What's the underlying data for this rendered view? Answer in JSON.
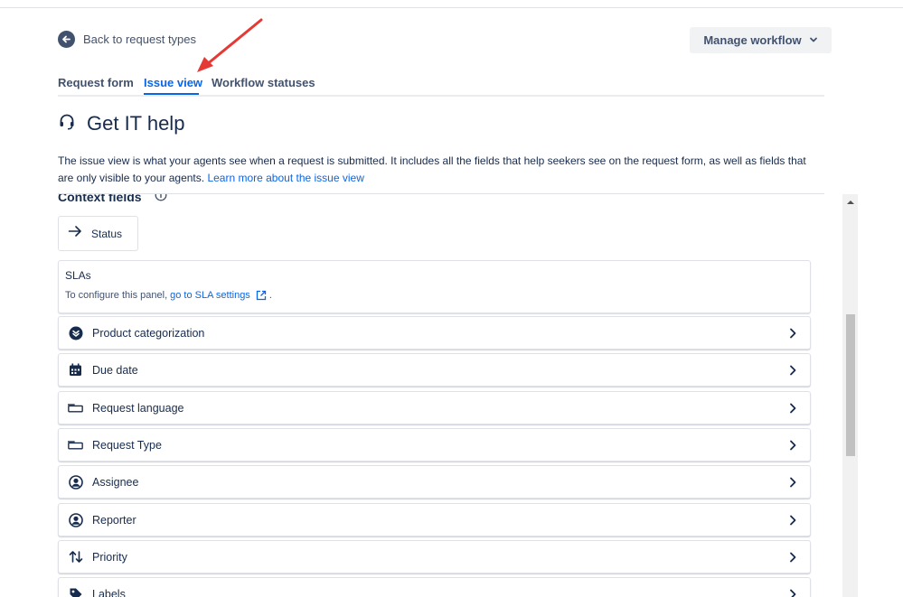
{
  "nav": {
    "back_label": "Back to request types",
    "back_icon": "arrow-left-circle-icon"
  },
  "header": {
    "manage_workflow_label": "Manage workflow",
    "manage_workflow_icon": "chevron-down-icon"
  },
  "tabs": [
    {
      "label": "Request form",
      "active": false
    },
    {
      "label": "Issue view",
      "active": true
    },
    {
      "label": "Workflow statuses",
      "active": false
    }
  ],
  "page": {
    "title": "Get IT help",
    "title_icon": "headset-icon",
    "description": "The issue view is what your agents see when a request is submitted. It includes all the fields that help seekers see on the request form, as well as fields that are only visible to your agents.",
    "learn_more_link": "Learn more about the issue view"
  },
  "context": {
    "heading": "Context fields",
    "info_icon": "info-icon",
    "status_label": "Status",
    "status_icon": "arrow-right-icon"
  },
  "sla": {
    "title": "SLAs",
    "text_prefix": "To configure this panel,",
    "link_label": "go to SLA settings",
    "link_icon": "external-link-icon",
    "text_suffix": "."
  },
  "fields": [
    {
      "label": "Product categorization",
      "icon": "cascading-select-icon"
    },
    {
      "label": "Due date",
      "icon": "calendar-icon"
    },
    {
      "label": "Request language",
      "icon": "text-field-icon"
    },
    {
      "label": "Request Type",
      "icon": "text-field-icon"
    },
    {
      "label": "Assignee",
      "icon": "user-avatar-icon"
    },
    {
      "label": "Reporter",
      "icon": "user-avatar-icon"
    },
    {
      "label": "Priority",
      "icon": "priority-arrows-icon"
    },
    {
      "label": "Labels",
      "icon": "tag-icon"
    }
  ],
  "colors": {
    "accent": "#0c66e4",
    "text": "#172b4d",
    "subtle_text": "#42526e",
    "annotation_arrow": "#e53935"
  }
}
